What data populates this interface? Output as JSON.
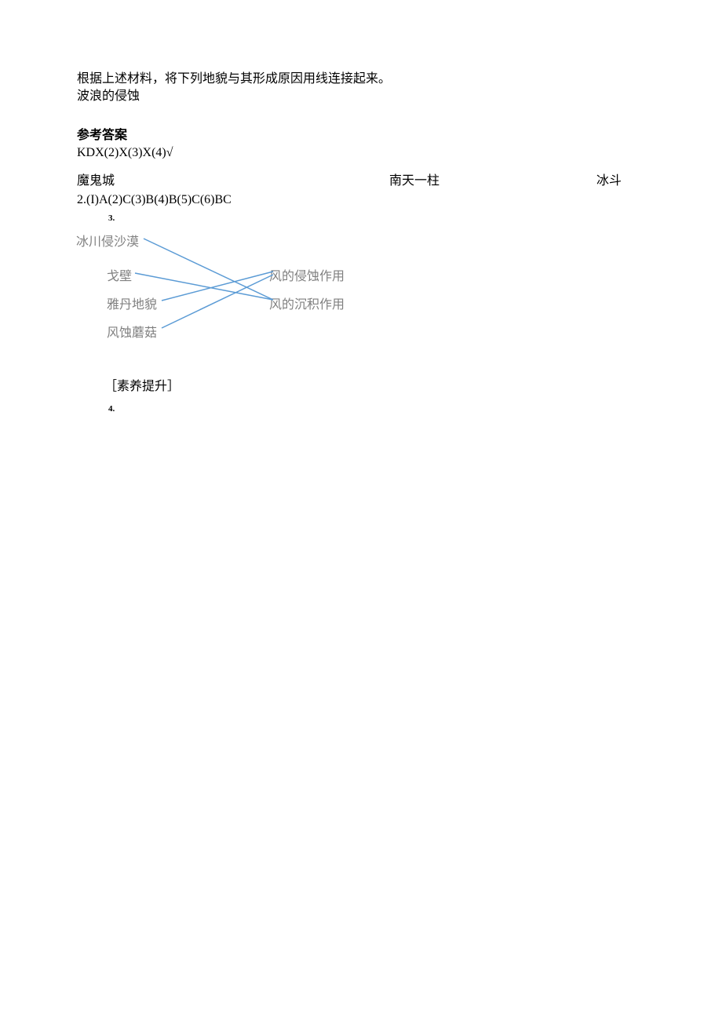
{
  "intro": {
    "line1": "根据上述材料，将下列地貌与其形成原因用线连接起来。",
    "line2": "波浪的侵蚀"
  },
  "heading": "参考答案",
  "answers": {
    "line1": "KDX(2)X(3)X(4)√",
    "line2": "2.(I)A(2)C(3)B(4)B(5)C(6)BC"
  },
  "threecol": {
    "c1": "魔鬼城",
    "c2": "南天一柱",
    "c3": "冰斗"
  },
  "nums": {
    "n3": "3.",
    "n4": "4."
  },
  "diagram": {
    "left": {
      "l0": "冰川侵沙漠",
      "l1": "戈壁",
      "l2": "雅丹地貌",
      "l3": "风蚀蘑菇"
    },
    "right": {
      "r1": "风的侵蚀作用",
      "r2": "风的沉积作用"
    }
  },
  "footer": "［素养提升］"
}
